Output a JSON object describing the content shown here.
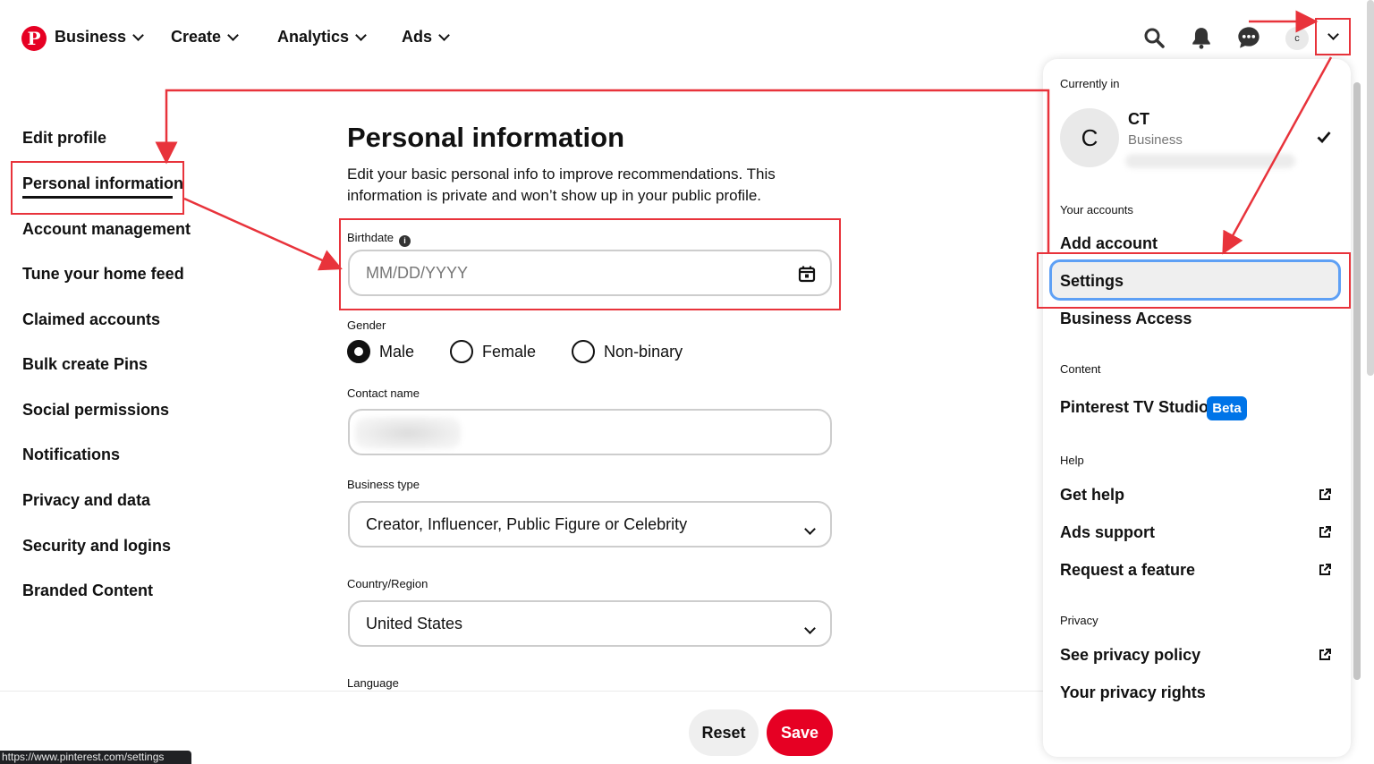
{
  "nav": {
    "brand": "Business",
    "items": [
      "Create",
      "Analytics",
      "Ads"
    ],
    "avatar_initial": "c"
  },
  "side_menu": {
    "items": [
      "Edit profile",
      "Personal information",
      "Account management",
      "Tune your home feed",
      "Claimed accounts",
      "Bulk create Pins",
      "Social permissions",
      "Notifications",
      "Privacy and data",
      "Security and logins",
      "Branded Content"
    ],
    "active": "Personal information"
  },
  "form": {
    "title": "Personal information",
    "description": "Edit your basic personal info to improve recommendations. This information is private and won’t show up in your public profile.",
    "birthdate_label": "Birthdate",
    "birthdate_placeholder": "MM/DD/YYYY",
    "gender_label": "Gender",
    "gender_options": [
      "Male",
      "Female",
      "Non-binary"
    ],
    "gender_selected": "Male",
    "contact_label": "Contact name",
    "business_type_label": "Business type",
    "business_type_value": "Creator, Influencer, Public Figure or Celebrity",
    "country_label": "Country/Region",
    "country_value": "United States",
    "language_label": "Language"
  },
  "buttons": {
    "reset": "Reset",
    "save": "Save"
  },
  "status_url": "https://www.pinterest.com/settings",
  "dropdown": {
    "currently_in": "Currently in",
    "account_initial": "C",
    "account_name": "CT",
    "account_type": "Business",
    "your_accounts": "Your accounts",
    "add_account": "Add account",
    "settings": "Settings",
    "business_access": "Business Access",
    "content_label": "Content",
    "tv_studio": "Pinterest TV Studio",
    "beta": "Beta",
    "help_label": "Help",
    "get_help": "Get help",
    "ads_support": "Ads support",
    "request_feature": "Request a feature",
    "privacy_label": "Privacy",
    "privacy_policy": "See privacy policy",
    "privacy_rights": "Your privacy rights"
  },
  "colors": {
    "brand_red": "#e60023",
    "annotation_red": "#e8333b",
    "focus_blue": "#5ea0f5",
    "beta_blue": "#0074e8"
  }
}
